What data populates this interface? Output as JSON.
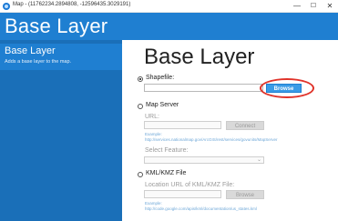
{
  "window": {
    "title": "Map - (11762234.2894808, -12596435.3029191)",
    "icon": "app-globe-icon",
    "controls": {
      "minimize": "—",
      "maximize": "☐",
      "close": "✕"
    }
  },
  "header": {
    "title": "Base Layer"
  },
  "sidebar": {
    "items": [
      {
        "label": "Base Layer",
        "description": "Adds a base layer to the map.",
        "active": true
      }
    ]
  },
  "main": {
    "title": "Base Layer",
    "shapefile": {
      "label": "Shapefile:",
      "selected": true,
      "value": "",
      "browse_label": "Browse"
    },
    "map_server": {
      "label": "Map Server",
      "selected": false,
      "url_label": "URL:",
      "url_value": "",
      "connect_label": "Connect",
      "example": "Example: http://services.nationalmap.gov/ArcGIS/rest/services/govunits/MapServer",
      "feature_label": "Select Feature:",
      "feature_value": ""
    },
    "kml": {
      "label": "KML/KMZ File",
      "selected": false,
      "url_label": "Location URL of KML/KMZ File:",
      "url_value": "",
      "browse_label": "Browse",
      "example": "Example: http://code.google.com/apis/kml/documentation/us_states.kml"
    }
  },
  "colors": {
    "accent": "#1f7fd1",
    "sidebar": "#1a6fb8",
    "highlight": "#e0332a",
    "primary_button": "#3a9be6"
  }
}
